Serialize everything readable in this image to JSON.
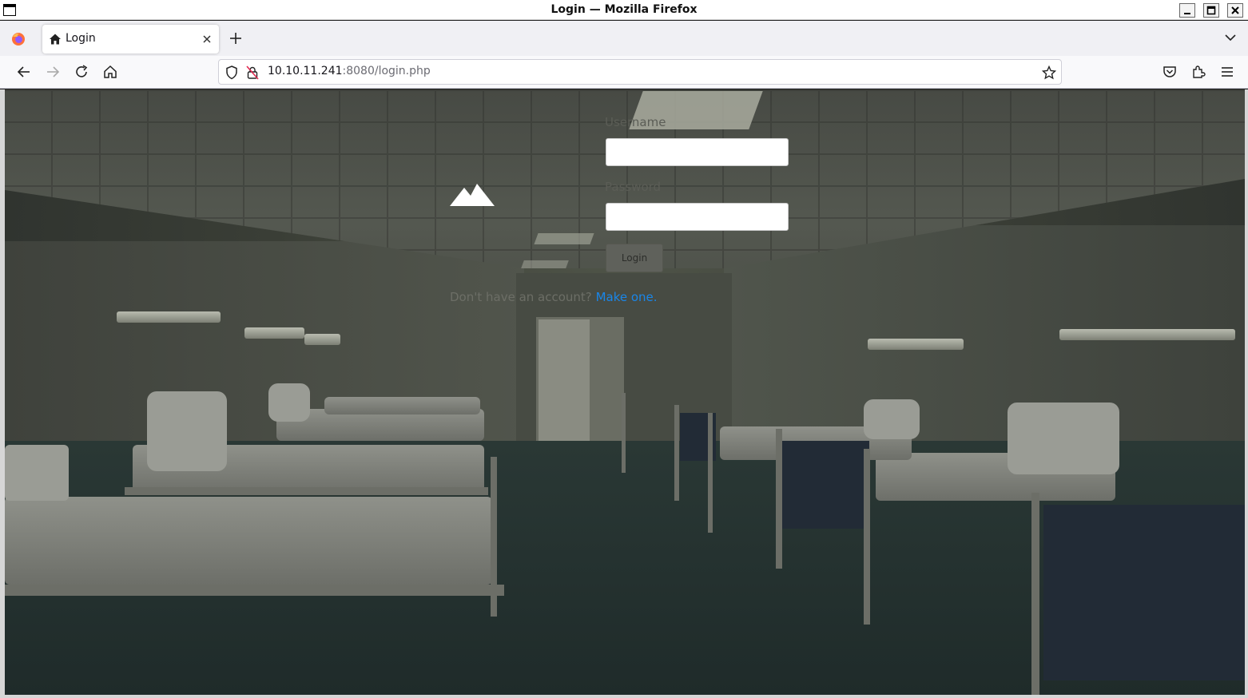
{
  "window": {
    "title": "Login — Mozilla Firefox"
  },
  "tabs": [
    {
      "label": "Login",
      "icon": "home-icon",
      "active": true
    }
  ],
  "navbar": {
    "url_host": "10.10.11.241",
    "url_rest": ":8080/login.php"
  },
  "login": {
    "username_label": "Username",
    "username_value": "",
    "password_label": "Password",
    "password_value": "",
    "login_button": "Login",
    "signup_text": "Don't have an account?",
    "signup_link": "Make one."
  },
  "colors": {
    "link": "#1a86e8",
    "page_overlay": "#3a3e36"
  }
}
